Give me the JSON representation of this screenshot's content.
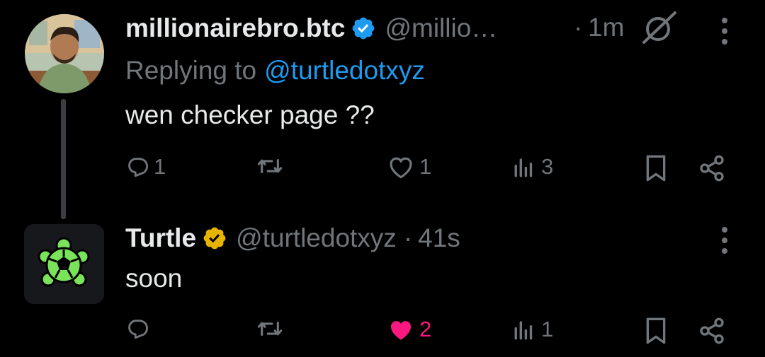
{
  "colors": {
    "background": "#000000",
    "text": "#e7e9ea",
    "muted": "#71767b",
    "link": "#1d9bf0",
    "like": "#f91880",
    "verified_blue": "#1d9bf0",
    "verified_gold": "#e6b400",
    "turtle_green": "#7ae35a"
  },
  "tweet1": {
    "name": "millionairebro.btc",
    "handle": "@millio…",
    "time_sep": "·",
    "time": "1m",
    "reply_prefix": "Replying to",
    "reply_handle": "@turtledotxyz",
    "text": "wen checker page ??",
    "stats": {
      "replies": "1",
      "reposts": "",
      "likes": "1",
      "views": "3"
    }
  },
  "tweet2": {
    "name": "Turtle",
    "handle": "@turtledotxyz",
    "time_sep": "·",
    "time": "41s",
    "text": "soon",
    "stats": {
      "replies": "",
      "reposts": "",
      "likes": "2",
      "views": "1"
    }
  }
}
